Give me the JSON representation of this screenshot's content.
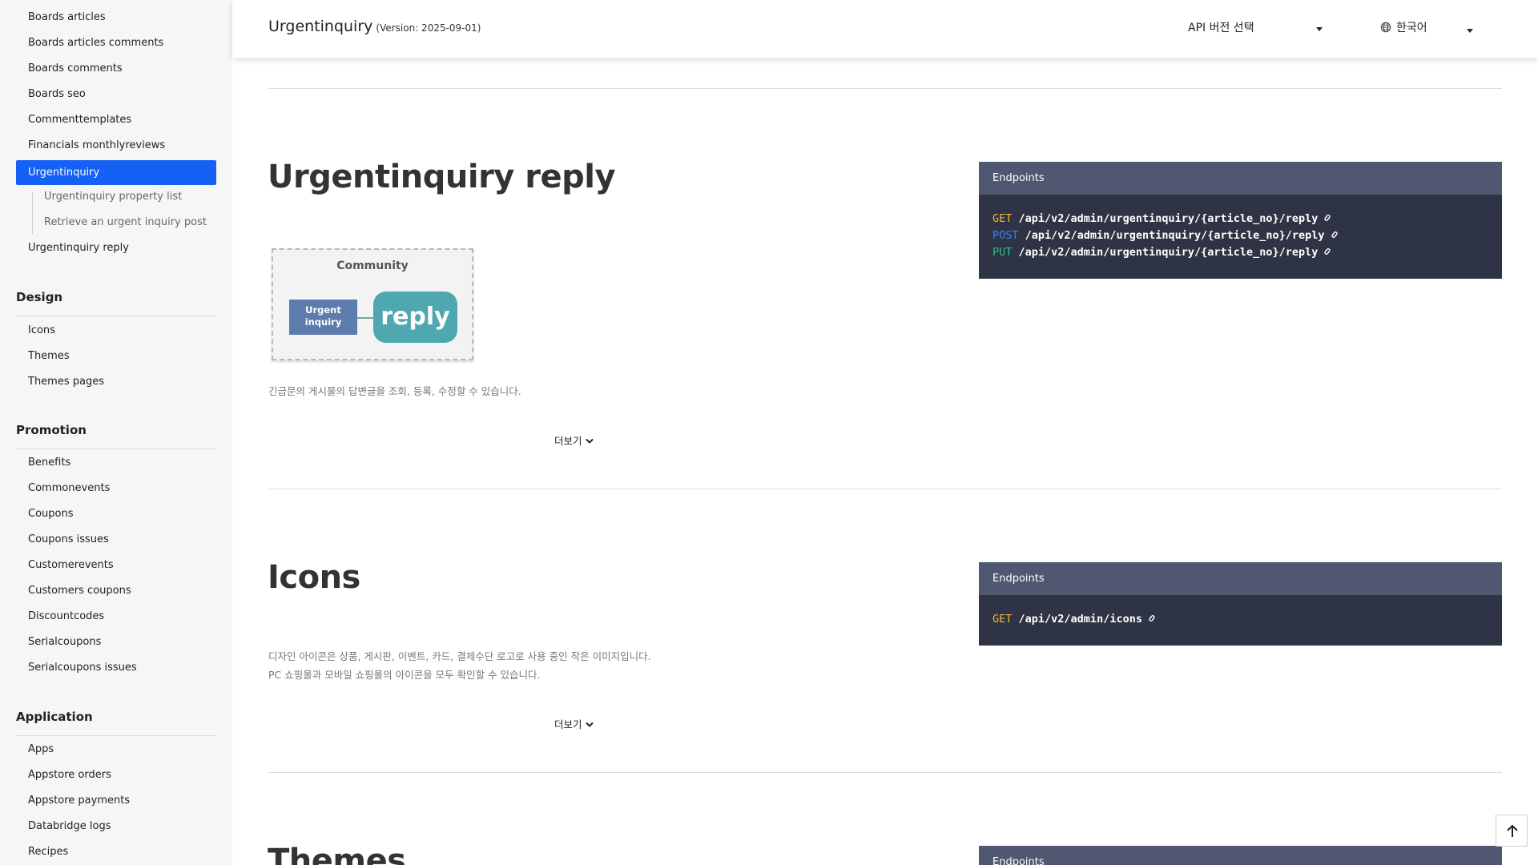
{
  "header": {
    "title": "Urgentinquiry",
    "version": "(Version: 2025-09-01)",
    "api_select": "API 버전 선택",
    "language": "한국어"
  },
  "sidebar": {
    "top_items": [
      "Boards articles",
      "Boards articles comments",
      "Boards comments",
      "Boards seo",
      "Commenttemplates",
      "Financials monthlyreviews"
    ],
    "active_item": "Urgentinquiry",
    "sub_items": [
      "Urgentinquiry property list",
      "Retrieve an urgent inquiry post"
    ],
    "after_item": "Urgentinquiry reply",
    "groups": [
      {
        "title": "Design",
        "items": [
          "Icons",
          "Themes",
          "Themes pages"
        ]
      },
      {
        "title": "Promotion",
        "items": [
          "Benefits",
          "Commonevents",
          "Coupons",
          "Coupons issues",
          "Customerevents",
          "Customers coupons",
          "Discountcodes",
          "Serialcoupons",
          "Serialcoupons issues"
        ]
      },
      {
        "title": "Application",
        "items": [
          "Apps",
          "Appstore orders",
          "Appstore payments",
          "Databridge logs",
          "Recipes"
        ]
      }
    ]
  },
  "sections": [
    {
      "title": "Urgentinquiry reply",
      "diagram": {
        "title": "Community",
        "left": "Urgent inquiry",
        "right": "reply"
      },
      "description": [
        "긴급문의 게시물의 답변글을 조회, 등록, 수정할 수 있습니다."
      ],
      "more": "더보기",
      "endpoints_label": "Endpoints",
      "endpoints": [
        {
          "method": "GET",
          "path": "/api/v2/admin/urgentinquiry/{article_no}/reply"
        },
        {
          "method": "POST",
          "path": "/api/v2/admin/urgentinquiry/{article_no}/reply"
        },
        {
          "method": "PUT",
          "path": "/api/v2/admin/urgentinquiry/{article_no}/reply"
        }
      ]
    },
    {
      "title": "Icons",
      "description": [
        "디자인 아이콘은 상품, 게시판, 이벤트, 카드, 결제수단 로고로 사용 중인 작은 이미지입니다.",
        "PC 쇼핑몰과 모바일 쇼핑몰의 아이콘을 모두 확인할 수 있습니다."
      ],
      "more": "더보기",
      "endpoints_label": "Endpoints",
      "endpoints": [
        {
          "method": "GET",
          "path": "/api/v2/admin/icons"
        }
      ]
    },
    {
      "title": "Themes",
      "endpoints_label": "Endpoints"
    }
  ],
  "colors": {
    "active": "#1560f5",
    "get": "#f5b533",
    "post": "#3a7ff0",
    "put": "#2fbf87",
    "endpoint_bg": "#2e3445",
    "endpoint_head": "#4f5870"
  },
  "icons": [
    "globe-icon",
    "caret-down-icon",
    "chevron-down-icon",
    "link-icon",
    "arrow-up-icon"
  ]
}
